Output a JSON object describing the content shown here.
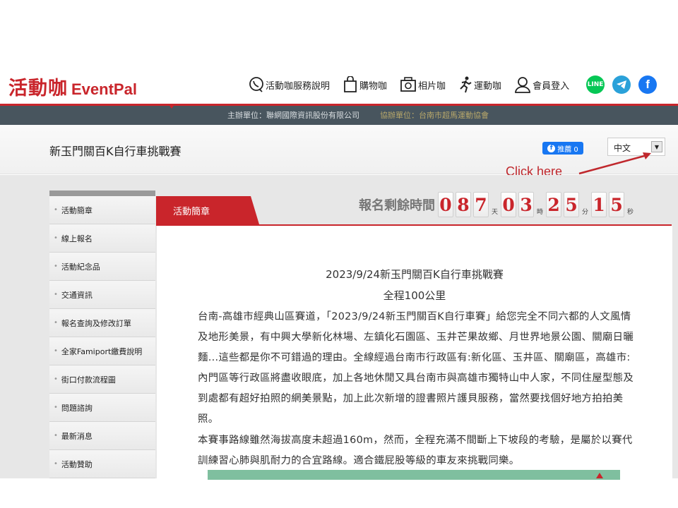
{
  "header": {
    "logo_cn": "活動咖",
    "logo_en": "EventPal",
    "nav": [
      {
        "label": "活動咖服務說明",
        "icon": "phone-icon"
      },
      {
        "label": "購物咖",
        "icon": "shopping-bag-icon"
      },
      {
        "label": "相片咖",
        "icon": "camera-icon"
      },
      {
        "label": "運動咖",
        "icon": "runner-icon"
      },
      {
        "label": "會員登入",
        "icon": "user-icon"
      }
    ],
    "social": [
      {
        "name": "line-icon",
        "text": "LINE",
        "color": "#06c755"
      },
      {
        "name": "telegram-icon",
        "text": "",
        "color": "#2aa1d9"
      },
      {
        "name": "facebook-icon",
        "text": "f",
        "color": "#1877f2"
      }
    ]
  },
  "sponsor": {
    "organizer": "主辦單位：聯網國際資訊股份有限公司",
    "co_organizer": "協辦單位：台南市超馬運動協會"
  },
  "event": {
    "title": "新玉門關百K自行車挑戰賽",
    "fb_share": "推薦 0",
    "language": "中文"
  },
  "annotation": {
    "click_here": "Click here"
  },
  "sidebar": {
    "items": [
      {
        "label": "活動簡章"
      },
      {
        "label": "線上報名"
      },
      {
        "label": "活動紀念品"
      },
      {
        "label": "交通資訊"
      },
      {
        "label": "報名查詢及修改訂單"
      },
      {
        "label": "全家Famiport繳費說明"
      },
      {
        "label": "街口付款流程圖"
      },
      {
        "label": "問題諮詢"
      },
      {
        "label": "最新消息"
      },
      {
        "label": "活動贊助"
      }
    ]
  },
  "tab": {
    "active": "活動簡章"
  },
  "countdown": {
    "label": "報名剩餘時間",
    "days": [
      "0",
      "8",
      "7"
    ],
    "days_unit": "天",
    "hours": [
      "0",
      "3"
    ],
    "hours_unit": "時",
    "minutes": [
      "2",
      "5"
    ],
    "minutes_unit": "分",
    "seconds": [
      "1",
      "5"
    ],
    "seconds_unit": "秒"
  },
  "content": {
    "heading": "2023/9/24新玉門關百K自行車挑戰賽",
    "subheading": "全程100公里",
    "paragraph1": "台南-高雄市經典山區賽道，「2023/9/24新玉門關百K自行車賽」給您完全不同六都的人文風情及地形美景，有中興大學新化林場、左鎮化石園區、玉井芒果故鄉、月世界地景公園、關廟日曬麵...這些都是你不可錯過的理由。全線經過台南市行政區有:新化區、玉井區、關廟區，高雄市:內門區等行政區將盡收眼底，加上各地休閒又具台南市與高雄市獨特山中人家，不同住屋型態及到處都有超好拍照的網美景點，加上此次新增的證書照片護貝服務，當然要找個好地方拍拍美照。",
    "paragraph2": "本賽事路線雖然海拔高度未超過160m，然而，全程充滿不間斷上下坡段的考驗，是屬於以賽代訓練習心肺與肌耐力的合宜路線。適合鐵屁股等級的車友來挑戰同樂。"
  },
  "colors": {
    "brand_red": "#c9252b",
    "bar": "#48555e",
    "fb": "#1877f2"
  }
}
